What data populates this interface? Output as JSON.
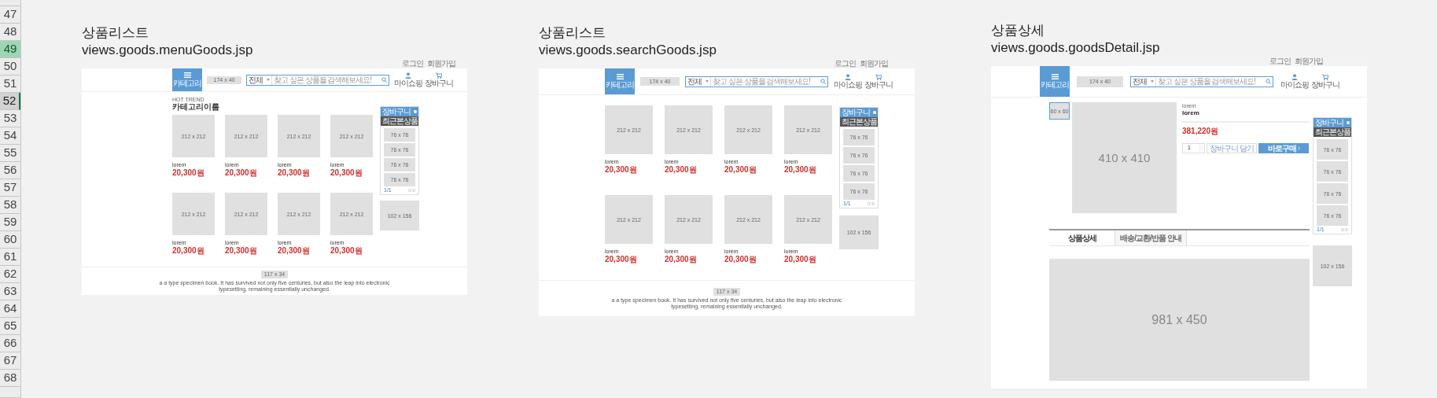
{
  "sheet": {
    "rows": [
      {
        "label": "47",
        "selected": false,
        "active": false
      },
      {
        "label": "48",
        "selected": false,
        "active": false
      },
      {
        "label": "49",
        "selected": true,
        "active": false
      },
      {
        "label": "50",
        "selected": false,
        "active": false
      },
      {
        "label": "51",
        "selected": false,
        "active": false
      },
      {
        "label": "52",
        "selected": false,
        "active": true
      },
      {
        "label": "53",
        "selected": false,
        "active": false
      },
      {
        "label": "54",
        "selected": false,
        "active": false
      },
      {
        "label": "55",
        "selected": false,
        "active": false
      },
      {
        "label": "56",
        "selected": false,
        "active": false
      },
      {
        "label": "57",
        "selected": false,
        "active": false
      },
      {
        "label": "58",
        "selected": false,
        "active": false
      },
      {
        "label": "59",
        "selected": false,
        "active": false
      },
      {
        "label": "60",
        "selected": false,
        "active": false
      },
      {
        "label": "61",
        "selected": false,
        "active": false
      },
      {
        "label": "62",
        "selected": false,
        "active": false
      },
      {
        "label": "63",
        "selected": false,
        "active": false
      },
      {
        "label": "64",
        "selected": false,
        "active": false
      },
      {
        "label": "65",
        "selected": false,
        "active": false
      },
      {
        "label": "66",
        "selected": false,
        "active": false
      },
      {
        "label": "67",
        "selected": false,
        "active": false
      },
      {
        "label": "68",
        "selected": false,
        "active": false
      }
    ]
  },
  "wireframes": [
    {
      "kind": "list",
      "title": "상품리스트",
      "file": "views.goods.menuGoods.jsp",
      "top_links": [
        "로그인",
        "회원가입"
      ],
      "header": {
        "menu_label": "카테고리",
        "logo": "174 x 40",
        "search_scope": "전체",
        "search_placeholder": "찾고 싶은 상품을 검색해보세요!",
        "actions": [
          {
            "kind": "user",
            "label": "마이쇼핑"
          },
          {
            "kind": "cart",
            "label": "장바구니"
          }
        ]
      },
      "section": {
        "eyebrow": "HOT TREND",
        "heading": "카테고리이름"
      },
      "products": [
        {
          "image": "212 x 212",
          "name": "lorem",
          "price": "20,300원"
        },
        {
          "image": "212 x 212",
          "name": "lorem",
          "price": "20,300원"
        },
        {
          "image": "212 x 212",
          "name": "lorem",
          "price": "20,300원"
        },
        {
          "image": "212 x 212",
          "name": "lorem",
          "price": "20,300원"
        },
        {
          "image": "212 x 212",
          "name": "lorem",
          "price": "20,300원"
        },
        {
          "image": "212 x 212",
          "name": "lorem",
          "price": "20,300원"
        },
        {
          "image": "212 x 212",
          "name": "lorem",
          "price": "20,300원"
        },
        {
          "image": "212 x 212",
          "name": "lorem",
          "price": "20,300원"
        }
      ],
      "side": {
        "cart_label": "장바구니",
        "recent_label": "최근본상품",
        "thumbs": [
          "76 x 76",
          "76 x 76",
          "76 x 76",
          "76 x 76"
        ],
        "pager": "1/1",
        "ad": "102 x 156"
      },
      "footer": {
        "logo": "117 x 34",
        "text": "a a type specimen book. It has survived not only five centuries, but also the leap into electronic typesetting, remaining essentially unchanged."
      }
    },
    {
      "kind": "list",
      "title": "상품리스트",
      "file": "views.goods.searchGoods.jsp",
      "top_links": [
        "로그인",
        "회원가입"
      ],
      "header": {
        "menu_label": "카테고리",
        "logo": "174 x 40",
        "search_scope": "전체",
        "search_placeholder": "찾고 싶은 상품을 검색해보세요!",
        "actions": [
          {
            "kind": "user",
            "label": "마이쇼핑"
          },
          {
            "kind": "cart",
            "label": "장바구니"
          }
        ]
      },
      "products": [
        {
          "image": "212 x 212",
          "name": "lorem",
          "price": "20,300원"
        },
        {
          "image": "212 x 212",
          "name": "lorem",
          "price": "20,300원"
        },
        {
          "image": "212 x 212",
          "name": "lorem",
          "price": "20,300원"
        },
        {
          "image": "212 x 212",
          "name": "lorem",
          "price": "20,300원"
        },
        {
          "image": "212 x 212",
          "name": "lorem",
          "price": "20,300원"
        },
        {
          "image": "212 x 212",
          "name": "lorem",
          "price": "20,300원"
        },
        {
          "image": "212 x 212",
          "name": "lorem",
          "price": "20,300원"
        },
        {
          "image": "212 x 212",
          "name": "lorem",
          "price": "20,300원"
        }
      ],
      "side": {
        "cart_label": "장바구니",
        "recent_label": "최근본상품",
        "thumbs": [
          "76 x 76",
          "76 x 76",
          "76 x 76",
          "76 x 76"
        ],
        "pager": "1/1",
        "ad": "102 x 156"
      },
      "footer": {
        "logo": "117 x 34",
        "text": "a a type specimen book. It has survived not only five centuries, but also the leap into electronic typesetting, remaining essentially unchanged."
      }
    },
    {
      "kind": "detail",
      "title": "상품상세",
      "file": "views.goods.goodsDetail.jsp",
      "top_links": [
        "로그인",
        "회원가입"
      ],
      "header": {
        "menu_label": "카테고리",
        "logo": "174 x 40",
        "search_scope": "전체",
        "search_placeholder": "찾고 싶은 상품을 검색해보세요!",
        "actions": [
          {
            "kind": "user",
            "label": "마이쇼핑"
          },
          {
            "kind": "cart",
            "label": "장바구니"
          }
        ]
      },
      "product": {
        "thumb": "60 x 60",
        "image": "410 x 410",
        "category": "lorem",
        "name": "lorem",
        "price": "381,220원",
        "quantity": "1",
        "cart_button": "장바구니 담기",
        "buy_button": "바로구매"
      },
      "tabs": [
        {
          "label": "상품상세",
          "selected": true
        },
        {
          "label": "배송/교환/반품 안내",
          "selected": false
        }
      ],
      "detail_image": "981 x 450",
      "side": {
        "cart_label": "장바구니",
        "recent_label": "최근본상품",
        "thumbs": [
          "76 x 76",
          "76 x 76",
          "76 x 76",
          "76 x 76"
        ],
        "pager": "1/1",
        "ad": "102 x 156"
      }
    }
  ]
}
